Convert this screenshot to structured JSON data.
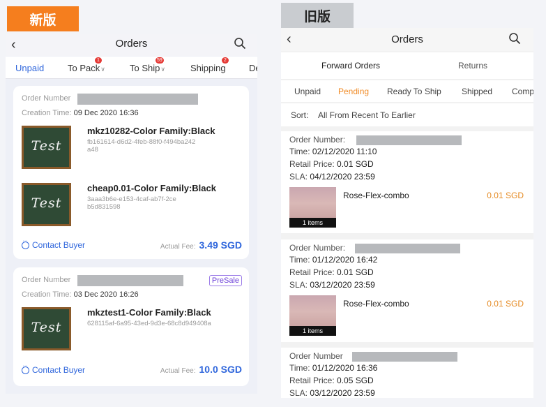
{
  "tags": {
    "new": "新版",
    "old": "旧版"
  },
  "new": {
    "title": "Orders",
    "tabs": [
      {
        "label": "Unpaid"
      },
      {
        "label": "To Pack",
        "badge": "1"
      },
      {
        "label": "To Ship",
        "badge": "59"
      },
      {
        "label": "Shipping",
        "badge": "2"
      },
      {
        "label": "De"
      }
    ],
    "orders": [
      {
        "order_number_label": "Order Number",
        "creation_label": "Creation Time:",
        "creation_time": "09 Dec 2020 16:36",
        "items": [
          {
            "thumb_text": "Test",
            "name": "mkz10282-Color Family:Black",
            "sku": "fb161614-d6d2-4feb-88f0-f494ba242a48"
          },
          {
            "thumb_text": "Test",
            "name": "cheap0.01-Color Family:Black",
            "sku": "3aaa3b6e-e153-4caf-ab7f-2ceb5d831598"
          }
        ],
        "contact": "Contact Buyer",
        "fee_label": "Actual Fee:",
        "fee": "3.49 SGD"
      },
      {
        "order_number_label": "Order Number",
        "badge": "PreSale",
        "creation_label": "Creation Time:",
        "creation_time": "03 Dec 2020 16:26",
        "items": [
          {
            "thumb_text": "Test",
            "name": "mkztest1-Color Family:Black",
            "sku": "628115af-6a95-43ed-9d3e-68c8d949408a"
          }
        ],
        "contact": "Contact Buyer",
        "fee_label": "Actual Fee:",
        "fee": "10.0 SGD"
      }
    ]
  },
  "old": {
    "title": "Orders",
    "segments": {
      "forward": "Forward Orders",
      "returns": "Returns"
    },
    "subtabs": [
      "Unpaid",
      "Pending",
      "Ready To Ship",
      "Shipped",
      "Comp"
    ],
    "sort": {
      "label": "Sort:",
      "value": "All From Recent To Earlier"
    },
    "orders": [
      {
        "order_label": "Order Number:",
        "time_label": "Time:",
        "time": "02/12/2020 11:10",
        "retail_label": "Retail Price:",
        "retail": "0.01 SGD",
        "sla_label": "SLA:",
        "sla": "04/12/2020 23:59",
        "items_text": "1 items",
        "product": "Rose-Flex-combo",
        "price": "0.01 SGD"
      },
      {
        "order_label": "Order Number:",
        "time_label": "Time:",
        "time": "01/12/2020 16:42",
        "retail_label": "Retail Price:",
        "retail": "0.01 SGD",
        "sla_label": "SLA:",
        "sla": "03/12/2020 23:59",
        "items_text": "1 items",
        "product": "Rose-Flex-combo",
        "price": "0.01 SGD"
      },
      {
        "order_label": "Order Number",
        "time_label": "Time:",
        "time": "01/12/2020 16:36",
        "retail_label": "Retail Price:",
        "retail": "0.05 SGD",
        "sla_label": "SLA:",
        "sla": "03/12/2020 23:59"
      }
    ]
  }
}
